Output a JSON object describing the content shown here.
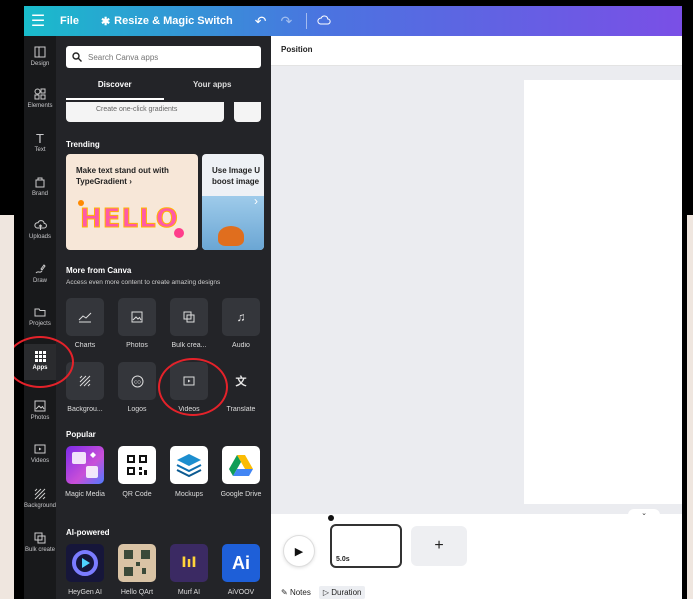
{
  "topbar": {
    "file_label": "File",
    "magic_label": "Resize & Magic Switch"
  },
  "rail": [
    {
      "label": "Design",
      "icon": "layout-icon"
    },
    {
      "label": "Elements",
      "icon": "shapes-icon"
    },
    {
      "label": "Text",
      "icon": "text-icon"
    },
    {
      "label": "Brand",
      "icon": "brand-icon"
    },
    {
      "label": "Uploads",
      "icon": "upload-cloud-icon"
    },
    {
      "label": "Draw",
      "icon": "draw-icon"
    },
    {
      "label": "Projects",
      "icon": "folder-icon"
    },
    {
      "label": "Apps",
      "icon": "apps-grid-icon"
    },
    {
      "label": "Photos",
      "icon": "image-icon"
    },
    {
      "label": "Videos",
      "icon": "video-icon"
    },
    {
      "label": "Background",
      "icon": "background-icon"
    },
    {
      "label": "Bulk create",
      "icon": "bulk-create-icon"
    }
  ],
  "panel": {
    "search_placeholder": "Search Canva apps",
    "tabs": [
      "Discover",
      "Your apps"
    ],
    "promo_text": "Create one-click gradients",
    "trending_title": "Trending",
    "trending_cards": [
      {
        "title": "Make text stand out with TypeGradient ›",
        "hero": "HELLO"
      },
      {
        "title": "Use Image U boost image"
      }
    ],
    "more_title": "More from Canva",
    "more_sub": "Access even more content to create amazing designs",
    "more_items": [
      {
        "label": "Charts",
        "icon": "chart-line-icon"
      },
      {
        "label": "Photos",
        "icon": "image-icon"
      },
      {
        "label": "Bulk crea...",
        "icon": "bulk-create-icon"
      },
      {
        "label": "Audio",
        "icon": "music-note-icon"
      },
      {
        "label": "Backgrou...",
        "icon": "background-icon"
      },
      {
        "label": "Logos",
        "icon": "logo-badge-icon"
      },
      {
        "label": "Videos",
        "icon": "video-icon"
      },
      {
        "label": "Translate",
        "icon": "translate-icon"
      }
    ],
    "popular_title": "Popular",
    "popular_items": [
      {
        "label": "Magic Media"
      },
      {
        "label": "QR Code"
      },
      {
        "label": "Mockups"
      },
      {
        "label": "Google Drive"
      }
    ],
    "ai_title": "AI-powered",
    "ai_items": [
      {
        "label": "HeyGen AI"
      },
      {
        "label": "Hello QArt"
      },
      {
        "label": "Murf AI",
        "glyph": "IıI"
      },
      {
        "label": "AiVOOV",
        "glyph": "Ai"
      }
    ]
  },
  "canvas": {
    "position_label": "Position"
  },
  "timeline": {
    "clip_duration": "5.0s",
    "add_glyph": "+",
    "notes_label": "Notes",
    "duration_label": "Duration"
  },
  "colors": {
    "highlight_circle": "#e4222a",
    "topbar_gradient_start": "#19bccb",
    "topbar_gradient_end": "#7a4fe6",
    "panel_bg": "#232428"
  }
}
